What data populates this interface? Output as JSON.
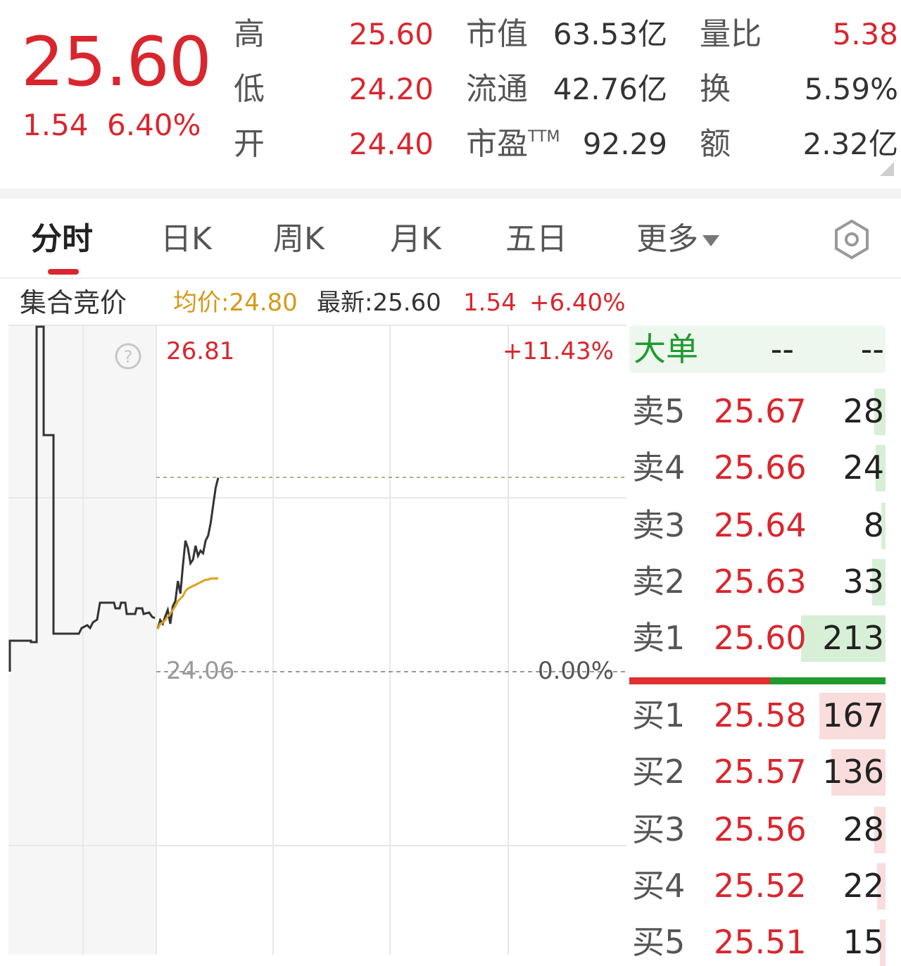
{
  "quote": {
    "price": "25.60",
    "change_abs": "1.54",
    "change_pct": "6.40%"
  },
  "stats": {
    "high_label": "高",
    "high_value": "25.60",
    "low_label": "低",
    "low_value": "24.20",
    "open_label": "开",
    "open_value": "24.40",
    "mcap_label": "市值",
    "mcap_value": "63.53亿",
    "float_label": "流通",
    "float_value": "42.76亿",
    "pe_label": "市盈",
    "pe_sup": "TTM",
    "pe_value": "92.29",
    "vol_ratio_label": "量比",
    "vol_ratio_value": "5.38",
    "turnover_label": "换",
    "turnover_value": "5.59%",
    "amount_label": "额",
    "amount_value": "2.32亿"
  },
  "tabs": [
    "分时",
    "日K",
    "周K",
    "月K",
    "五日"
  ],
  "tab_more": "更多",
  "info_line": {
    "auction_label": "集合竞价",
    "avg": "均价:24.80",
    "latest": "最新:25.60",
    "change_abs": "1.54",
    "change_pct": "+6.40%"
  },
  "chart_labels": {
    "top_price": "26.81",
    "top_pct": "+11.43%",
    "base_price": "24.06",
    "base_pct": "0.00%"
  },
  "colors": {
    "up": "#d9262e",
    "down": "#1f9a2e",
    "avg_line": "#e0a020",
    "price_line": "#333333"
  },
  "chart_data": {
    "type": "line",
    "x": [
      0,
      1,
      2,
      3,
      4,
      5,
      6,
      7,
      8,
      9,
      10,
      11,
      12,
      13,
      14,
      15,
      16,
      17,
      18,
      19,
      20,
      21,
      22,
      23,
      24
    ],
    "series": [
      {
        "values": [
          24.4,
          24.47,
          24.44,
          24.5,
          24.55,
          24.44,
          24.58,
          24.62,
          24.78,
          24.68,
          24.9,
          25.1,
          25.04,
          24.92,
          24.95,
          25.06,
          24.98,
          25.02,
          25.0,
          25.1,
          25.14,
          25.24,
          25.38,
          25.52,
          25.6
        ]
      },
      {
        "values": [
          24.4,
          24.44,
          24.45,
          24.47,
          24.5,
          24.52,
          24.55,
          24.58,
          24.62,
          24.64,
          24.66,
          24.7,
          24.72,
          24.73,
          24.74,
          24.75,
          24.76,
          24.77,
          24.78,
          24.79,
          24.79,
          24.8,
          24.8,
          24.8,
          24.8
        ]
      }
    ],
    "ylim": [
      21.31,
      26.81
    ],
    "prev_close": 24.06
  },
  "order_book": {
    "big_order_label": "大单",
    "big_order_v1": "--",
    "big_order_v2": "--",
    "asks": [
      {
        "label": "卖5",
        "price": "25.67",
        "vol": "28"
      },
      {
        "label": "卖4",
        "price": "25.66",
        "vol": "24"
      },
      {
        "label": "卖3",
        "price": "25.64",
        "vol": "8"
      },
      {
        "label": "卖2",
        "price": "25.63",
        "vol": "33"
      },
      {
        "label": "卖1",
        "price": "25.60",
        "vol": "213"
      }
    ],
    "bids": [
      {
        "label": "买1",
        "price": "25.58",
        "vol": "167"
      },
      {
        "label": "买2",
        "price": "25.57",
        "vol": "136"
      },
      {
        "label": "买3",
        "price": "25.56",
        "vol": "28"
      },
      {
        "label": "买4",
        "price": "25.52",
        "vol": "22"
      },
      {
        "label": "买5",
        "price": "25.51",
        "vol": "15"
      }
    ],
    "buy_sell_ratio": 0.55
  }
}
